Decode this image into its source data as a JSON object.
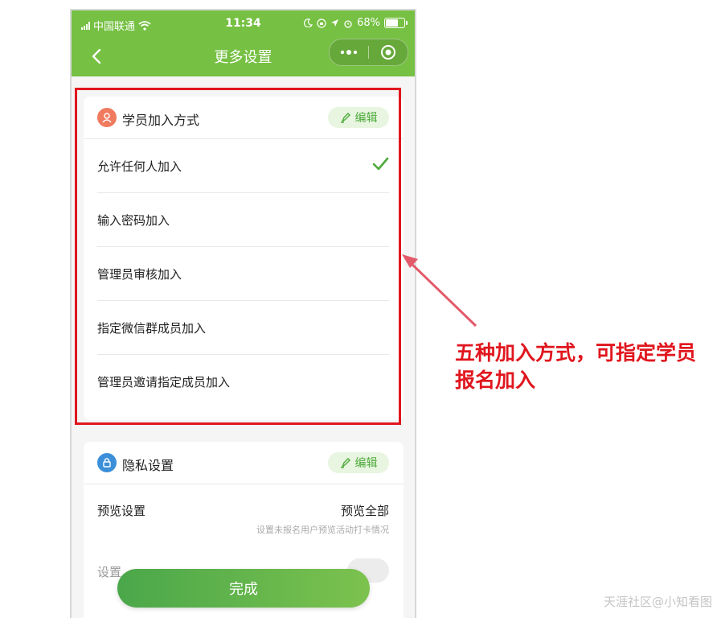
{
  "status_bar": {
    "carrier": "中国联通",
    "time": "11:34",
    "battery": "68%",
    "battery_level": 0.68
  },
  "navbar": {
    "title": "更多设置"
  },
  "join_card": {
    "title": "学员加入方式",
    "edit_label": "编辑",
    "options": [
      {
        "label": "允许任何人加入",
        "selected": true
      },
      {
        "label": "输入密码加入",
        "selected": false
      },
      {
        "label": "管理员审核加入",
        "selected": false
      },
      {
        "label": "指定微信群成员加入",
        "selected": false
      },
      {
        "label": "管理员邀请指定成员加入",
        "selected": false
      }
    ]
  },
  "privacy_card": {
    "title": "隐私设置",
    "edit_label": "编辑",
    "preview_label": "预览设置",
    "preview_value": "预览全部",
    "preview_hint": "设置未报名用户预览活动打卡情况",
    "next_label_partial": "设置"
  },
  "done_button": "完成",
  "annotation": "五种加入方式，可指定学员报名加入",
  "watermark": "天涯社区@小知看图",
  "colors": {
    "theme_green": "#76c043",
    "annotation_red": "#e0161e",
    "check_green": "#4caa3a"
  }
}
